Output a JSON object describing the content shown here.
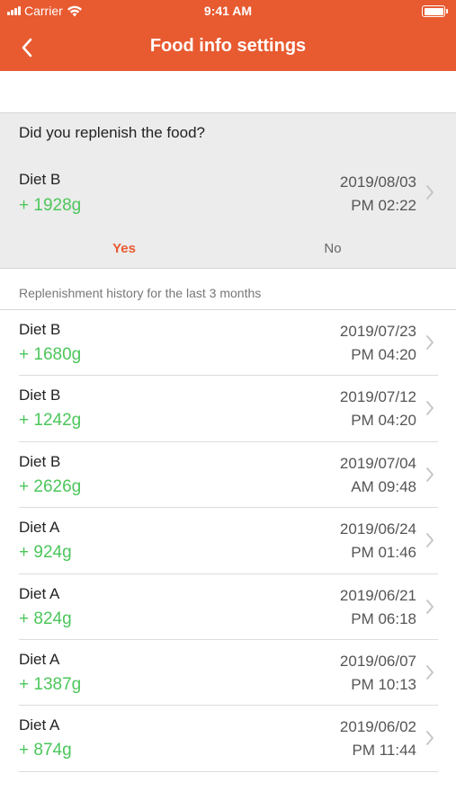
{
  "status_bar": {
    "carrier": "Carrier",
    "time": "9:41 AM"
  },
  "nav": {
    "title": "Food info settings"
  },
  "prompt": {
    "question": "Did you replenish the food?",
    "entry": {
      "name": "Diet B",
      "amount": "+ 1928g",
      "date": "2019/08/03",
      "time": "PM 02:22"
    },
    "yes_label": "Yes",
    "no_label": "No"
  },
  "history": {
    "header": "Replenishment history for the last 3 months",
    "items": [
      {
        "name": "Diet B",
        "amount": "+ 1680g",
        "date": "2019/07/23",
        "time": "PM 04:20"
      },
      {
        "name": "Diet B",
        "amount": "+ 1242g",
        "date": "2019/07/12",
        "time": "PM 04:20"
      },
      {
        "name": "Diet B",
        "amount": "+ 2626g",
        "date": "2019/07/04",
        "time": "AM 09:48"
      },
      {
        "name": "Diet A",
        "amount": "+ 924g",
        "date": "2019/06/24",
        "time": "PM 01:46"
      },
      {
        "name": "Diet A",
        "amount": "+ 824g",
        "date": "2019/06/21",
        "time": "PM 06:18"
      },
      {
        "name": "Diet A",
        "amount": "+ 1387g",
        "date": "2019/06/07",
        "time": "PM 10:13"
      },
      {
        "name": "Diet A",
        "amount": "+ 874g",
        "date": "2019/06/02",
        "time": "PM 11:44"
      }
    ]
  },
  "colors": {
    "accent": "#e85a30",
    "amount_green": "#4cc65b",
    "prompt_bg": "#ececec"
  },
  "icons": {
    "back": "chevron-left-icon",
    "row": "chevron-right-icon",
    "wifi": "wifi-icon",
    "battery": "battery-icon"
  }
}
